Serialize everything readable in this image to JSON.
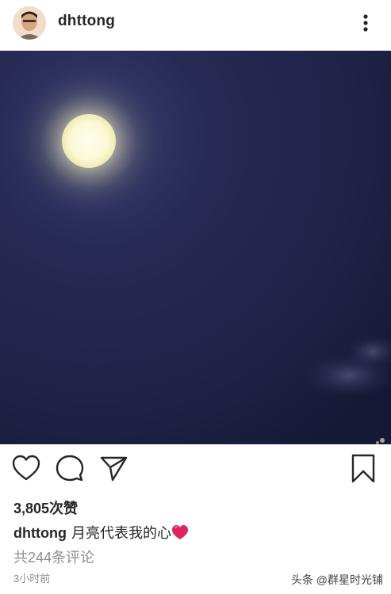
{
  "header": {
    "username": "dhttong",
    "more_icon": "more-vertical-icon"
  },
  "post": {
    "image_description_icon": "moon-photo",
    "likes": "3,805次赞",
    "caption_user": "dhttong",
    "caption_text": "月亮代表我的心",
    "caption_emoji": "red-heart-icon",
    "comments_link": "共244条评论",
    "timestamp": "3小时前"
  },
  "actions": {
    "like_icon": "heart-outline-icon",
    "comment_icon": "comment-bubble-icon",
    "share_icon": "paper-plane-icon",
    "save_icon": "bookmark-icon"
  },
  "watermark": "头条 @群星时光铺",
  "colors": {
    "text": "#262626",
    "secondary_text": "#8e8e8e",
    "night_sky": "#1f2347",
    "heart_red": "#e0245e"
  }
}
